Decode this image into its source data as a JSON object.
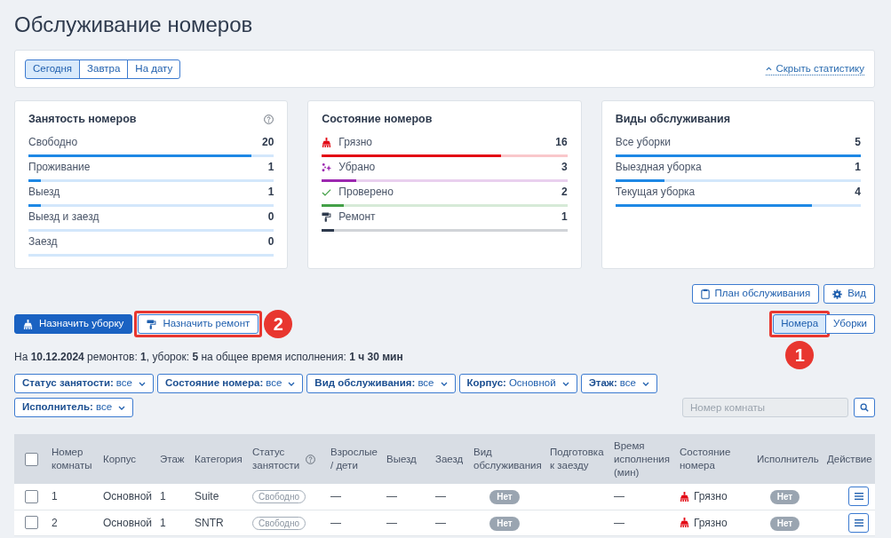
{
  "page": {
    "title": "Обслуживание номеров"
  },
  "date_tabs": [
    {
      "label": "Сегодня",
      "selected": true
    },
    {
      "label": "Завтра",
      "selected": false
    },
    {
      "label": "На дату",
      "selected": false
    }
  ],
  "stats_toggle": {
    "label": "Скрыть статистику",
    "expanded": true
  },
  "stat_cards": [
    {
      "title": "Занятость номеров",
      "help": true,
      "items": [
        {
          "label": "Свободно",
          "value": "20",
          "level": 0.91
        },
        {
          "label": "Проживание",
          "value": "1",
          "level": 0.05
        },
        {
          "label": "Выезд",
          "value": "1",
          "level": 0.05
        },
        {
          "label": "Выезд и заезд",
          "value": "0",
          "level": 0
        },
        {
          "label": "Заезд",
          "value": "0",
          "level": 0
        }
      ]
    },
    {
      "title": "Состояние номеров",
      "items": [
        {
          "kind": "dirty",
          "label": "Грязно",
          "value": "16",
          "level": 0.73,
          "color": "#e30613"
        },
        {
          "kind": "cleaned",
          "label": "Убрано",
          "value": "3",
          "level": 0.14,
          "color": "#9c27b0"
        },
        {
          "kind": "inspected",
          "label": "Проверено",
          "value": "2",
          "level": 0.09,
          "color": "#43a047"
        },
        {
          "kind": "repair",
          "label": "Ремонт",
          "value": "1",
          "level": 0.05,
          "color": "#2e3a4d"
        }
      ]
    },
    {
      "title": "Виды обслуживания",
      "items": [
        {
          "label": "Все уборки",
          "value": "5",
          "level": 1
        },
        {
          "label": "Выездная уборка",
          "value": "1",
          "level": 0.2
        },
        {
          "label": "Текущая уборка",
          "value": "4",
          "level": 0.8
        }
      ]
    }
  ],
  "toolbar": [
    {
      "label": "План обслуживания"
    },
    {
      "label": "Вид"
    }
  ],
  "assign_buttons": [
    {
      "label": "Назначить уборку",
      "kind": "primary"
    },
    {
      "label": "Назначить ремонт",
      "kind": "secondary",
      "callout": "2"
    }
  ],
  "view_tabs": [
    {
      "label": "Номера",
      "selected": true,
      "callout": "1"
    },
    {
      "label": "Уборки",
      "selected": false
    }
  ],
  "summary": "На **10.12.2024** ремонтов: **1**, уборок: **5** на общее время исполнения: **1 ч 30 мин**",
  "filters": [
    {
      "label": "Статус занятости:",
      "value": "все"
    },
    {
      "label": "Состояние номера:",
      "value": "все"
    },
    {
      "label": "Вид обслуживания:",
      "value": "все"
    },
    {
      "label": "Корпус:",
      "value": "Основной"
    },
    {
      "label": "Этаж:",
      "value": "все"
    },
    {
      "label": "Исполнитель:",
      "value": "все"
    }
  ],
  "room_search": {
    "placeholder": "Номер комнаты"
  },
  "table": {
    "select_all": {
      "checked": false
    },
    "columns": [
      {
        "label": "Номер комнаты"
      },
      {
        "label": "Корпус"
      },
      {
        "label": "Этаж"
      },
      {
        "label": "Категория"
      },
      {
        "label": "Статус занятости",
        "help": true
      },
      {
        "label": "Взрослые / дети"
      },
      {
        "label": "Выезд"
      },
      {
        "label": "Заезд"
      },
      {
        "label": "Вид обслуживания"
      },
      {
        "label": "Подготовка к заезду"
      },
      {
        "label": "Время исполнения (мин)"
      },
      {
        "label": "Состояние номера"
      },
      {
        "label": "Исполнитель"
      },
      {
        "label": "Действие"
      }
    ],
    "rows": [
      {
        "checked": false,
        "room": "1",
        "building": "Основной",
        "floor": "1",
        "category": "Suite",
        "occupancy": "Свободно",
        "guests": "—",
        "departure": "—",
        "arrival": "—",
        "service": "Нет",
        "duration": "—",
        "state": {
          "kind": "dirty",
          "label": "Грязно"
        },
        "assignee": "Нет"
      },
      {
        "checked": false,
        "room": "2",
        "building": "Основной",
        "floor": "1",
        "category": "SNTR",
        "occupancy": "Свободно",
        "guests": "—",
        "departure": "—",
        "arrival": "—",
        "service": "Нет",
        "duration": "—",
        "state": {
          "kind": "dirty",
          "label": "Грязно"
        },
        "assignee": "Нет"
      }
    ]
  }
}
